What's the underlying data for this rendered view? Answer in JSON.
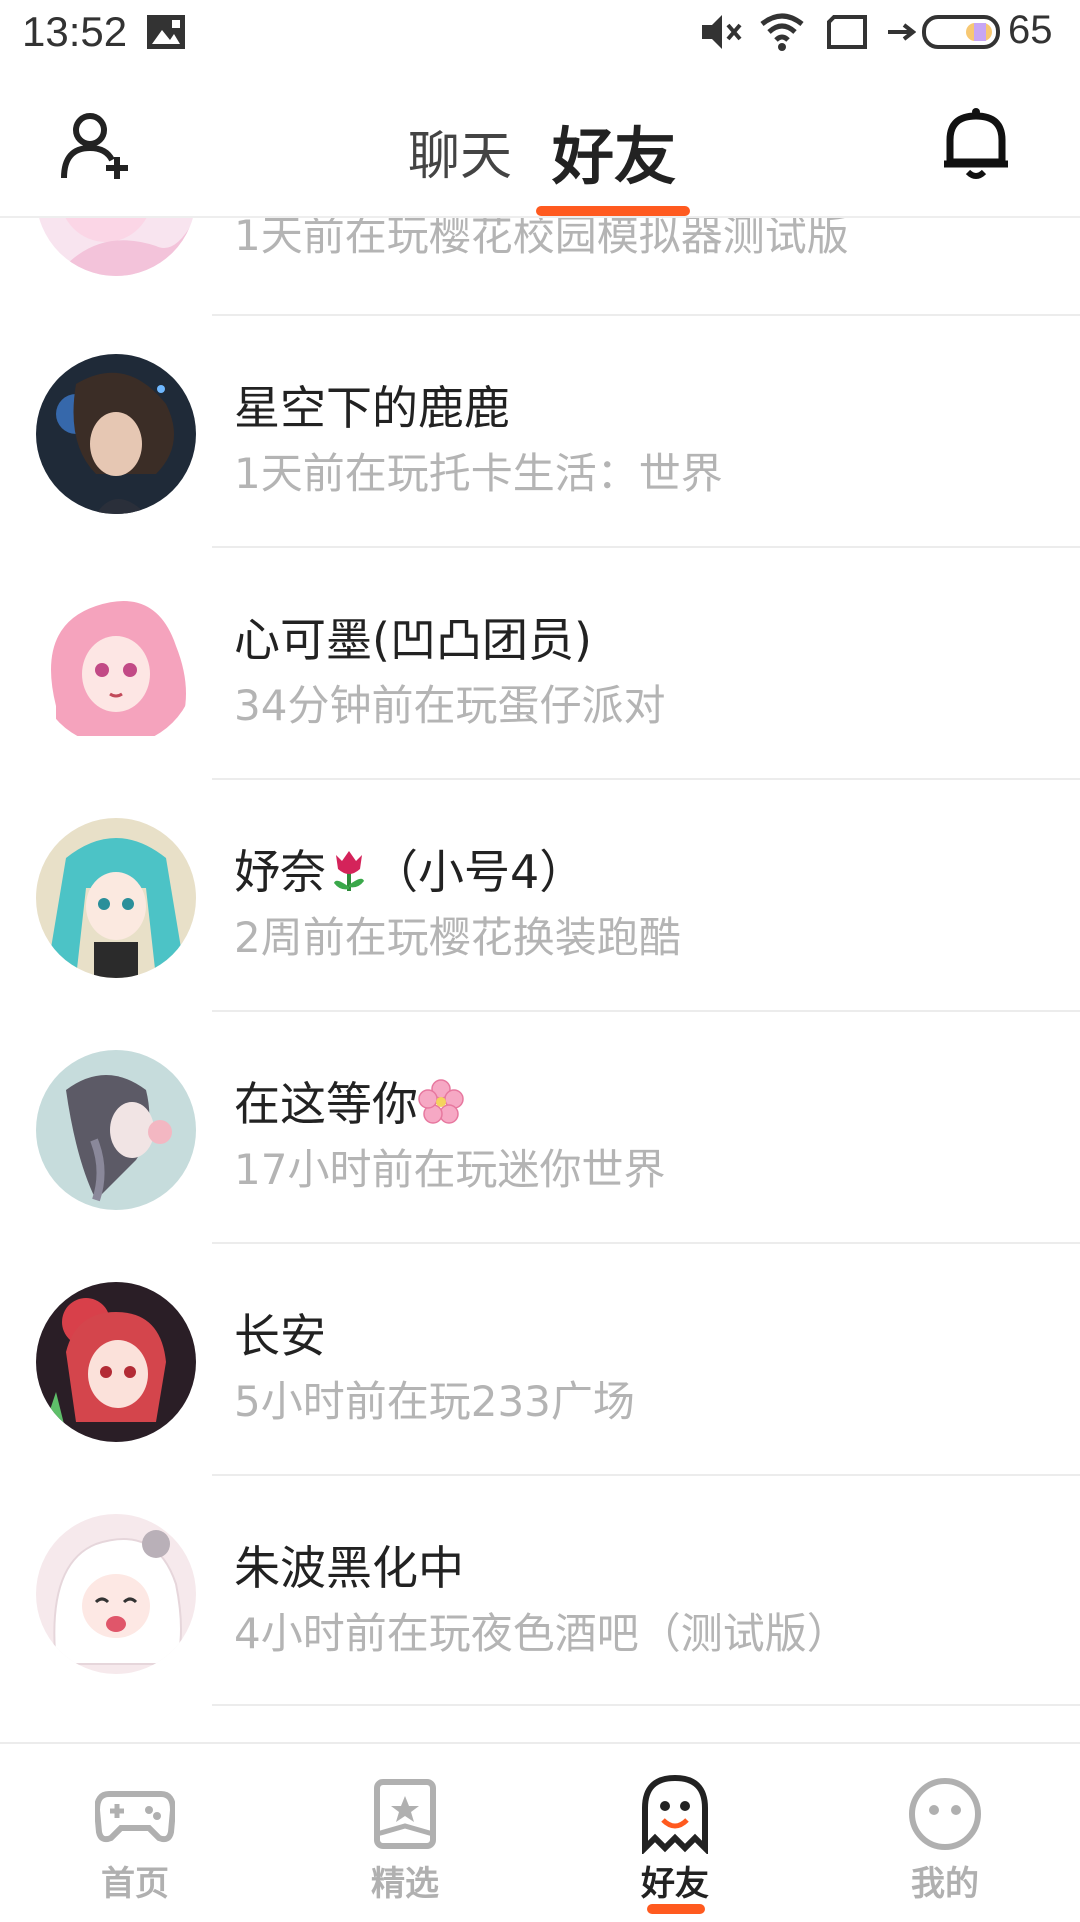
{
  "status_bar": {
    "time": "13:52",
    "battery_level": "65",
    "icons": [
      "image-notification-icon",
      "mute-icon",
      "wifi-icon",
      "screen-icon",
      "charging-arrow-icon",
      "battery-icon"
    ]
  },
  "header": {
    "tabs": [
      {
        "label": "聊天",
        "active": false
      },
      {
        "label": "好友",
        "active": true
      }
    ],
    "accent_color": "#ff5a1f"
  },
  "friends": [
    {
      "name": "",
      "status": "1天前在玩樱花校园模拟器测试版",
      "avatar": "anime-avatar-pink-partial"
    },
    {
      "name": "星空下的鹿鹿",
      "status": "1天前在玩托卡生活：世界",
      "avatar": "anime-avatar-dark-blue"
    },
    {
      "name": "心可墨(凹凸团员)",
      "status": "34分钟前在玩蛋仔派对",
      "avatar": "anime-avatar-pink-hair"
    },
    {
      "name": "妤奈",
      "name_emoji": "tulip",
      "name_suffix": "（小号4）",
      "status": "2周前在玩樱花换装跑酷",
      "avatar": "anime-avatar-teal-twintails"
    },
    {
      "name": "在这等你",
      "name_emoji": "cherry-blossom",
      "status": "17小时前在玩迷你世界",
      "avatar": "anime-avatar-pale-braid"
    },
    {
      "name": "长安",
      "status": "5小时前在玩233广场",
      "avatar": "anime-avatar-red-hair"
    },
    {
      "name": "朱波黑化中",
      "status": "4小时前在玩夜色酒吧（测试版）",
      "avatar": "anime-avatar-white-hair"
    }
  ],
  "bottom_nav": [
    {
      "label": "首页",
      "icon": "gamepad-icon",
      "active": false
    },
    {
      "label": "精选",
      "icon": "star-card-icon",
      "active": false
    },
    {
      "label": "好友",
      "icon": "ghost-icon",
      "active": true
    },
    {
      "label": "我的",
      "icon": "smiley-face-icon",
      "active": false
    }
  ]
}
